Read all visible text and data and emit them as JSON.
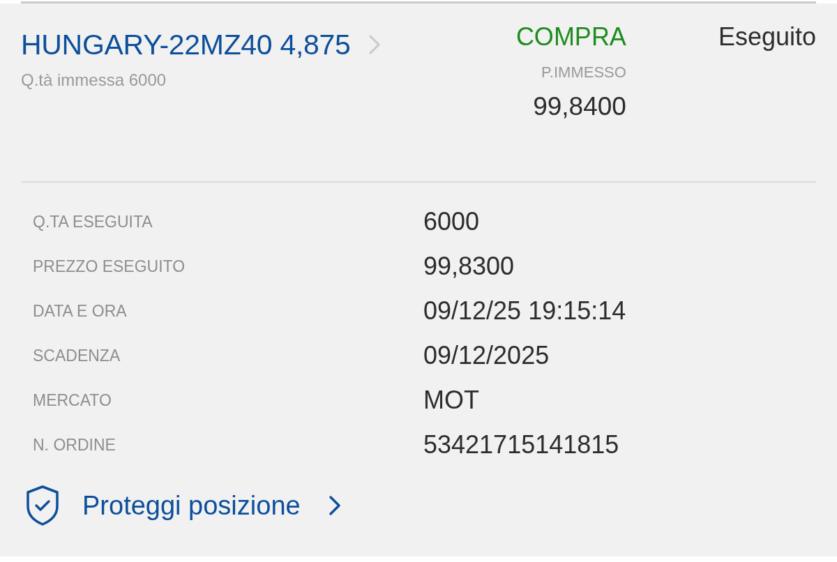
{
  "order": {
    "title": "HUNGARY-22MZ40 4,875",
    "quantity_entered": "Q.tà immessa 6000",
    "side": {
      "kind": "buy",
      "label": "COMPRA"
    },
    "price_label": "P.IMMESSO",
    "price_value": "99,8400",
    "status": "Eseguito"
  },
  "details": [
    {
      "label": "Q.TA ESEGUITA",
      "value": "6000"
    },
    {
      "label": "PREZZO ESEGUITO",
      "value": "99,8300"
    },
    {
      "label": "DATA E ORA",
      "value": "09/12/25 19:15:14"
    },
    {
      "label": "SCADENZA",
      "value": "09/12/2025"
    },
    {
      "label": "MERCATO",
      "value": "MOT"
    },
    {
      "label": "N. ORDINE",
      "value": "53421715141815"
    }
  ],
  "action": {
    "label": "Proteggi posizione"
  }
}
